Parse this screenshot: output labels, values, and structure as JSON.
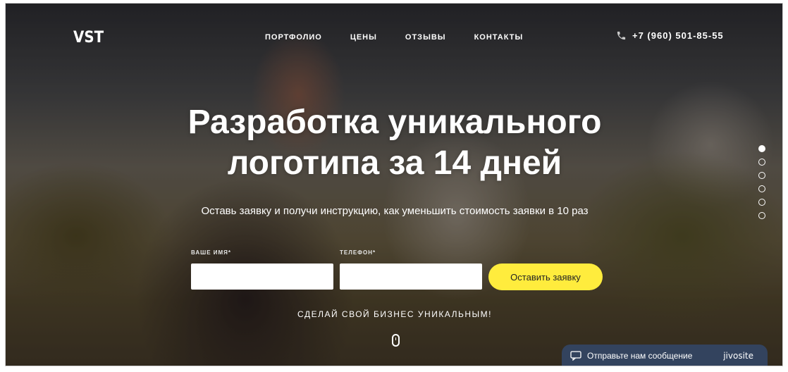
{
  "brand": {
    "logo": "VST"
  },
  "nav": {
    "items": [
      "ПОРТФОЛИО",
      "ЦЕНЫ",
      "ОТЗЫВЫ",
      "КОНТАКТЫ"
    ]
  },
  "header": {
    "phone": "+7 (960) 501-85-55",
    "phone_icon": "phone-icon"
  },
  "hero": {
    "title_line1": "Разработка уникального",
    "title_line2": "логотипа за 14 дней",
    "subtitle": "Оставь заявку и получи инструкцию, как уменьшить стоимость заявки в 10 раз"
  },
  "form": {
    "name_label": "ВАШЕ ИМЯ*",
    "name_value": "",
    "phone_label": "ТЕЛЕФОН*",
    "phone_value": "",
    "submit_label": "Оставить заявку"
  },
  "tagline": "СДЕЛАЙ СВОЙ БИЗНЕС УНИКАЛЬНЫМ!",
  "slider": {
    "count": 6,
    "active_index": 0
  },
  "chat": {
    "label": "Отправьте нам сообщение",
    "brand": "jivosite",
    "background": "#344462"
  },
  "colors": {
    "accent": "#ffec3d",
    "text": "#ffffff"
  }
}
